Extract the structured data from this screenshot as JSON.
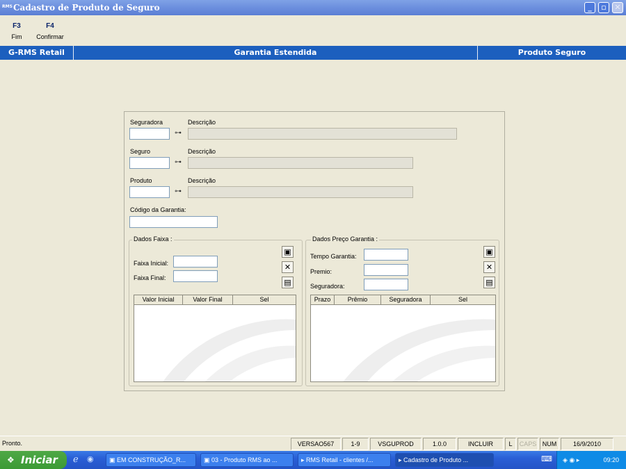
{
  "window": {
    "title": "Cadastro de Produto de Seguro",
    "app_icon_text": "RMS"
  },
  "toolbar": [
    {
      "key": "F3",
      "label": "Fim"
    },
    {
      "key": "F4",
      "label": "Confirmar"
    }
  ],
  "header": {
    "left": "G-RMS Retail",
    "center": "Garantia Estendida",
    "right": "Produto Seguro"
  },
  "form": {
    "seguradora_label": "Seguradora",
    "seguradora_desc_label": "Descrição",
    "seguro_label": "Seguro",
    "seguro_desc_label": "Descrição",
    "produto_label": "Produto",
    "produto_desc_label": "Descrição",
    "codigo_garantia_label": "Código da Garantia:"
  },
  "faixa": {
    "legend": "Dados Faixa :",
    "inicial_label": "Faixa Inicial:",
    "final_label": "Faixa Final:",
    "columns": [
      "Valor Inicial",
      "Valor Final",
      "Sel"
    ]
  },
  "preco": {
    "legend": "Dados Preço Garantia :",
    "tempo_label": "Tempo Garantia:",
    "premio_label": "Premio:",
    "seguradora_label": "Seguradora:",
    "columns": [
      "Prazo",
      "Prêmio",
      "Seguradora",
      "Sel"
    ]
  },
  "status": {
    "message": "Pronto.",
    "version": "VERSAO567",
    "range": "1-9",
    "program": "VSGUPROD",
    "release": "1.0.0",
    "mode": "INCLUIR",
    "l": "L",
    "caps": "CAPS",
    "num": "NUM",
    "date": "16/9/2010"
  },
  "taskbar": {
    "start": "Iniciar",
    "tasks": [
      "EM CONSTRUÇÃO_R...",
      "03 - Produto RMS ao ...",
      "RMS Retail - clientes /...",
      "Cadastro de Produto ..."
    ],
    "clock": "09:20"
  },
  "icons": {
    "binoculars": "binoculars-icon",
    "save": "save-icon",
    "delete": "delete-icon",
    "new": "new-document-icon"
  }
}
